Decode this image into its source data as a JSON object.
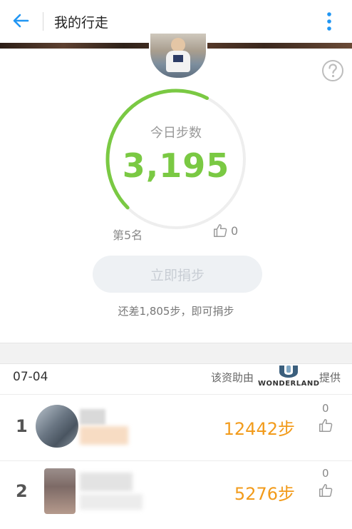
{
  "app_bar": {
    "title": "我的行走"
  },
  "today": {
    "label": "今日步数",
    "steps": "3,195",
    "progress_fraction": 0.6
  },
  "rank": {
    "text": "第5名",
    "likes": "0"
  },
  "donate": {
    "button_label": "立即捐步",
    "hint": "还差1,805步，即可捐步"
  },
  "list_header": {
    "date": "07-04",
    "sponsor_prefix": "该资助由",
    "sponsor_brand": "WONDERLAND",
    "sponsor_suffix": "提供"
  },
  "leaderboard": [
    {
      "rank": "1",
      "steps": "12442步",
      "likes": "0"
    },
    {
      "rank": "2",
      "steps": "5276步",
      "likes": "0"
    }
  ],
  "colors": {
    "accent_green": "#7ac943",
    "steps_orange": "#f29b1b",
    "link_blue": "#2196f3"
  }
}
